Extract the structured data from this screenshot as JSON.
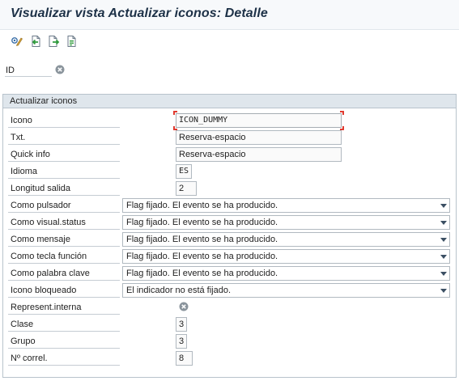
{
  "window": {
    "title": "Visualizar vista Actualizar iconos: Detalle"
  },
  "toolbar": {
    "buttons": [
      {
        "icon": "display-change-icon"
      },
      {
        "icon": "previous-entry-icon"
      },
      {
        "icon": "next-entry-icon"
      },
      {
        "icon": "select-entry-icon"
      }
    ]
  },
  "key": {
    "label": "ID",
    "clear_icon": "clear-icon"
  },
  "group": {
    "title": "Actualizar iconos",
    "fields": {
      "icono": {
        "label": "Icono",
        "value": "ICON_DUMMY"
      },
      "txt": {
        "label": "Txt.",
        "value": "Reserva-espacio"
      },
      "quickinfo": {
        "label": "Quick info",
        "value": "Reserva-espacio"
      },
      "idioma": {
        "label": "Idioma",
        "value": "ES"
      },
      "longitud": {
        "label": "Longitud salida",
        "value": "2"
      },
      "pulsador": {
        "label": "Como pulsador",
        "value": "Flag fijado. El evento se ha producido."
      },
      "status": {
        "label": "Como visual.status",
        "value": "Flag fijado. El evento se ha producido."
      },
      "mensaje": {
        "label": "Como mensaje",
        "value": "Flag fijado. El evento se ha producido."
      },
      "tecla": {
        "label": "Como tecla función",
        "value": "Flag fijado. El evento se ha producido."
      },
      "palabra": {
        "label": "Como palabra clave",
        "value": "Flag fijado. El evento se ha producido."
      },
      "bloqueado": {
        "label": "Icono bloqueado",
        "value": "El indicador no está fijado."
      },
      "interna": {
        "label": "Represent.interna",
        "icon": "clear-icon"
      },
      "clase": {
        "label": "Clase",
        "value": "3"
      },
      "grupo": {
        "label": "Grupo",
        "value": "3"
      },
      "correl": {
        "label": "Nº correl.",
        "value": "8"
      }
    }
  },
  "colors": {
    "title_text": "#1d3147",
    "group_header_bg": "#dfe6ec",
    "focus_corner": "#e03a2f"
  }
}
